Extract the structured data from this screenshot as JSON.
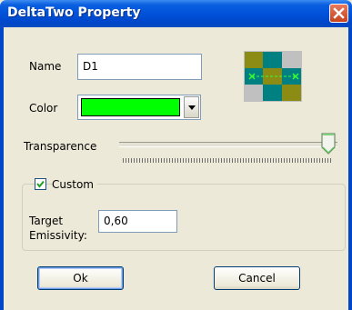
{
  "window": {
    "title": "DeltaTwo Property"
  },
  "name_field": {
    "label": "Name",
    "value": "D1"
  },
  "color_field": {
    "label": "Color",
    "value_color": "#00ff00"
  },
  "transparence": {
    "label": "Transparence",
    "level": 1.0
  },
  "custom": {
    "label": "Custom",
    "checked": true
  },
  "emissivity": {
    "label_line1": "Target",
    "label_line2": "Emissivity:",
    "value": "0,60"
  },
  "buttons": {
    "ok": "Ok",
    "cancel": "Cancel"
  },
  "colors": {
    "titlebar": "#0050d8",
    "dialog_bg": "#ece9d8",
    "swatch": "#00ff00",
    "preview_olive": "#8c8c14",
    "preview_teal": "#008080",
    "preview_gray": "#c0c0c0"
  },
  "icons": {
    "close": "close-icon",
    "dropdown": "chevron-down-icon",
    "check": "check-icon",
    "preview": "texture-preview-icon",
    "slider": "slider-thumb"
  }
}
